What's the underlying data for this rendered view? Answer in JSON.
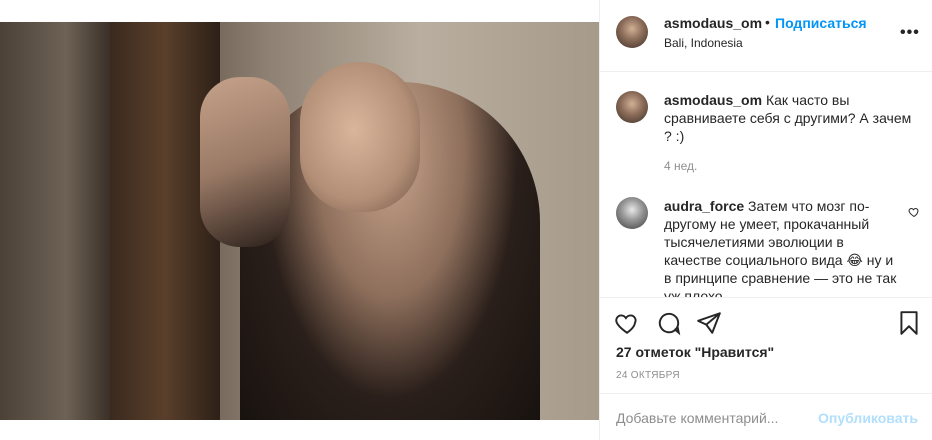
{
  "post": {
    "image_alt": "post-photo"
  },
  "header": {
    "username": "asmodaus_om",
    "separator": "•",
    "follow_label": "Подписаться",
    "location": "Bali, Indonesia",
    "more_label": "•••"
  },
  "comments": [
    {
      "author": "asmodaus_om",
      "text": "Как часто вы сравниваете себя с другими? А зачем ? :)",
      "meta": "4 нед."
    },
    {
      "author": "audra_force",
      "text": "Затем что мозг по-другому не умеет, прокачанный тысячелетиями эволюции в качестве социального вида 😂 ну и в принципе сравнение — это не так уж плохо"
    }
  ],
  "actions": {
    "likes": "27 отметок \"Нравится\"",
    "date": "24 ОКТЯБРЯ"
  },
  "add_comment": {
    "placeholder": "Добавьте комментарий...",
    "post_label": "Опубликовать"
  },
  "colors": {
    "accent": "#0095f6",
    "post_disabled": "#b2dffc",
    "muted": "#8e8e8e"
  }
}
